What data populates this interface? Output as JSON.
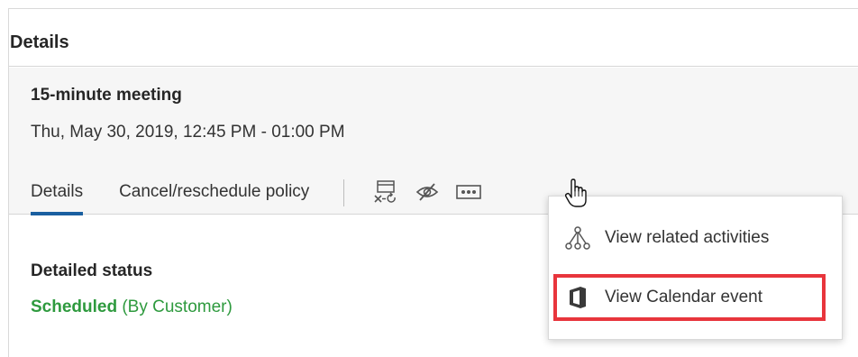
{
  "panel": {
    "title": "Details"
  },
  "meeting": {
    "title": "15-minute meeting",
    "time": "Thu, May 30, 2019, 12:45 PM - 01:00 PM"
  },
  "tabs": [
    {
      "label": "Details",
      "active": true
    },
    {
      "label": "Cancel/reschedule policy",
      "active": false
    }
  ],
  "toolbar": {
    "icons": [
      "cancel-reschedule-icon",
      "hide-icon",
      "more-options-icon"
    ]
  },
  "status": {
    "label": "Detailed status",
    "value": "Scheduled",
    "qualifier": "(By Customer)"
  },
  "menu": {
    "items": [
      {
        "label": "View related activities",
        "icon": "related-activities-icon"
      },
      {
        "label": "View Calendar event",
        "icon": "office-icon"
      }
    ]
  },
  "colors": {
    "accent": "#1a5fa0",
    "status_green": "#2e9a3e",
    "highlight_red": "#e8353c"
  }
}
